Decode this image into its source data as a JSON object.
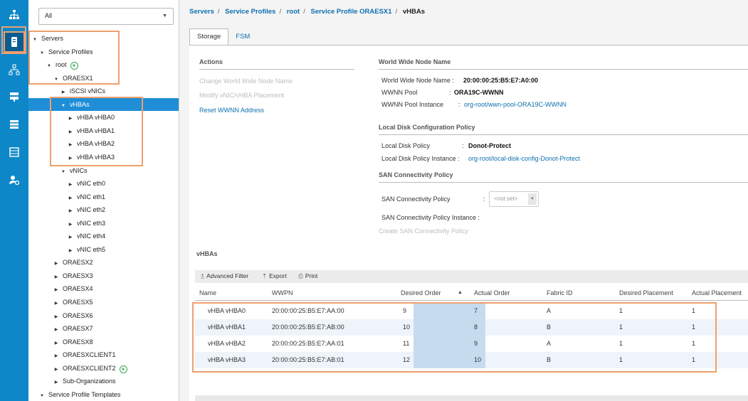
{
  "rail": {
    "icons": [
      "equipment-icon",
      "servers-icon",
      "lan-icon",
      "san-icon",
      "storage-icon",
      "chassis-icon",
      "admin-icon"
    ]
  },
  "filter": {
    "value": "All"
  },
  "tree": [
    {
      "label": "Servers",
      "indent": 0,
      "arrow": "down",
      "selected": false,
      "add": false
    },
    {
      "label": "Service Profiles",
      "indent": 1,
      "arrow": "down",
      "selected": false,
      "add": false
    },
    {
      "label": "root",
      "indent": 2,
      "arrow": "down",
      "selected": false,
      "add": true
    },
    {
      "label": "ORAESX1",
      "indent": 3,
      "arrow": "down",
      "selected": false,
      "add": false
    },
    {
      "label": "iSCSI vNICs",
      "indent": 4,
      "arrow": "right",
      "selected": false,
      "add": false
    },
    {
      "label": "vHBAs",
      "indent": 4,
      "arrow": "down",
      "selected": true,
      "add": false
    },
    {
      "label": "vHBA vHBA0",
      "indent": 5,
      "arrow": "right",
      "selected": false,
      "add": false
    },
    {
      "label": "vHBA vHBA1",
      "indent": 5,
      "arrow": "right",
      "selected": false,
      "add": false
    },
    {
      "label": "vHBA vHBA2",
      "indent": 5,
      "arrow": "right",
      "selected": false,
      "add": false
    },
    {
      "label": "vHBA vHBA3",
      "indent": 5,
      "arrow": "right",
      "selected": false,
      "add": false
    },
    {
      "label": "vNICs",
      "indent": 4,
      "arrow": "down",
      "selected": false,
      "add": false
    },
    {
      "label": "vNIC eth0",
      "indent": 5,
      "arrow": "right",
      "selected": false,
      "add": false
    },
    {
      "label": "vNIC eth1",
      "indent": 5,
      "arrow": "right",
      "selected": false,
      "add": false
    },
    {
      "label": "vNIC eth2",
      "indent": 5,
      "arrow": "right",
      "selected": false,
      "add": false
    },
    {
      "label": "vNIC eth3",
      "indent": 5,
      "arrow": "right",
      "selected": false,
      "add": false
    },
    {
      "label": "vNIC eth4",
      "indent": 5,
      "arrow": "right",
      "selected": false,
      "add": false
    },
    {
      "label": "vNIC eth5",
      "indent": 5,
      "arrow": "right",
      "selected": false,
      "add": false
    },
    {
      "label": "ORAESX2",
      "indent": 3,
      "arrow": "right",
      "selected": false,
      "add": false
    },
    {
      "label": "ORAESX3",
      "indent": 3,
      "arrow": "right",
      "selected": false,
      "add": false
    },
    {
      "label": "ORAESX4",
      "indent": 3,
      "arrow": "right",
      "selected": false,
      "add": false
    },
    {
      "label": "ORAESX5",
      "indent": 3,
      "arrow": "right",
      "selected": false,
      "add": false
    },
    {
      "label": "ORAESX6",
      "indent": 3,
      "arrow": "right",
      "selected": false,
      "add": false
    },
    {
      "label": "ORAESX7",
      "indent": 3,
      "arrow": "right",
      "selected": false,
      "add": false
    },
    {
      "label": "ORAESX8",
      "indent": 3,
      "arrow": "right",
      "selected": false,
      "add": false
    },
    {
      "label": "ORAESXCLIENT1",
      "indent": 3,
      "arrow": "right",
      "selected": false,
      "add": false
    },
    {
      "label": "ORAESXCLIENT2",
      "indent": 3,
      "arrow": "right",
      "selected": false,
      "add": true
    },
    {
      "label": "Sub-Organizations",
      "indent": 3,
      "arrow": "right",
      "selected": false,
      "add": false
    },
    {
      "label": "Service Profile Templates",
      "indent": 1,
      "arrow": "down",
      "selected": false,
      "add": false
    }
  ],
  "breadcrumb": [
    "Servers",
    "Service Profiles",
    "root",
    "Service Profile ORAESX1",
    "vHBAs"
  ],
  "tabs": [
    "Storage",
    "FSM"
  ],
  "actions": {
    "title": "Actions",
    "items": [
      {
        "label": "Change World Wide Node Name",
        "enabled": false
      },
      {
        "label": "Modify vNIC/vHBA Placement",
        "enabled": false
      },
      {
        "label": "Reset WWNN Address",
        "enabled": true
      }
    ]
  },
  "wwnn": {
    "title": "World Wide Node Name",
    "name_label": "World Wide Node Name :",
    "name_value": "20:00:00:25:B5:E7:A0:00",
    "pool_label": "WWNN Pool",
    "pool_value": "ORA19C-WWNN",
    "instance_label": "WWNN Pool Instance",
    "instance_value": "org-root/wwn-pool-ORA19C-WWNN"
  },
  "local_disk": {
    "title": "Local Disk Configuration Policy",
    "policy_label": "Local Disk Policy",
    "policy_value": "Donot-Protect",
    "instance_label": "Local Disk Policy Instance :",
    "instance_value": "org-root/local-disk-config-Donot-Protect"
  },
  "san": {
    "title": "SAN Connectivity Policy",
    "policy_label": "SAN Connectivity Policy",
    "policy_value": "<not set>",
    "instance_label": "SAN Connectivity Policy Instance :",
    "create_label": "Create SAN Connectivity Policy"
  },
  "vhbas": {
    "title": "vHBAs",
    "toolbar": {
      "filter": "Advanced Filter",
      "export": "Export",
      "print": "Print"
    },
    "columns": [
      "Name",
      "WWPN",
      "Desired Order",
      "Actual Order",
      "Fabric ID",
      "Desired Placement",
      "Actual Placement"
    ],
    "rows": [
      [
        "vHBA vHBA0",
        "20:00:00:25:B5:E7:AA:00",
        "9",
        "7",
        "A",
        "1",
        "1"
      ],
      [
        "vHBA vHBA1",
        "20:00:00:25:B5:E7:AB:00",
        "10",
        "8",
        "B",
        "1",
        "1"
      ],
      [
        "vHBA vHBA2",
        "20:00:00:25:B5:E7:AA:01",
        "11",
        "9",
        "A",
        "1",
        "1"
      ],
      [
        "vHBA vHBA3",
        "20:00:00:25:B5:E7:AB:01",
        "12",
        "10",
        "B",
        "1",
        "1"
      ]
    ]
  },
  "colors": {
    "rail": "#0e87c9",
    "selected": "#1f8ed6",
    "highlight": "#ef9f6e",
    "link": "#0e6fb0"
  }
}
